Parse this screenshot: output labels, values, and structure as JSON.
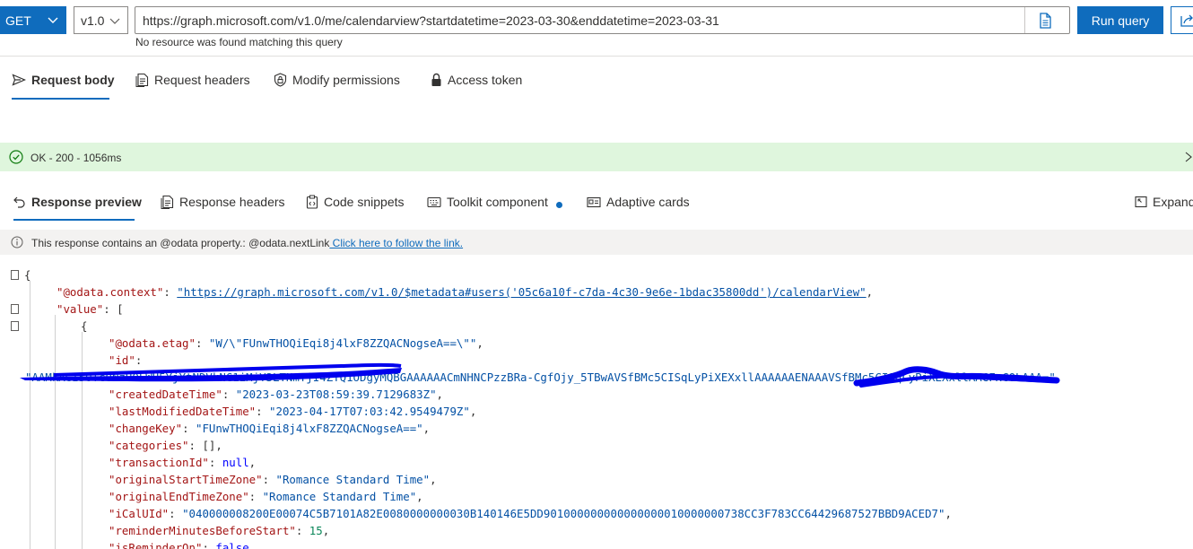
{
  "query": {
    "method": "GET",
    "version": "v1.0",
    "url": "https://graph.microsoft.com/v1.0/me/calendarview?startdatetime=2023-03-30&enddatetime=2023-03-31",
    "hint": "No resource was found matching this query",
    "run_label": "Run query"
  },
  "request_tabs": {
    "body": "Request body",
    "headers": "Request headers",
    "permissions": "Modify permissions",
    "token": "Access token"
  },
  "status": {
    "text": "OK - 200 - 1056ms"
  },
  "response_tabs": {
    "preview": "Response preview",
    "headers": "Response headers",
    "snippets": "Code snippets",
    "toolkit": "Toolkit component",
    "cards": "Adaptive cards",
    "expand": "Expand"
  },
  "info": {
    "text": "This response contains an @odata property.: @odata.nextLink",
    "link": " Click here to follow the link."
  },
  "json": {
    "open_brace": "{",
    "l1_key": "\"@odata.context\"",
    "l1_colon": ": ",
    "l1_value": "\"https://graph.microsoft.com/v1.0/$metadata#users('05c6a10f-c7da-4c30-9e6e-1bdac35800dd')/calendarView\"",
    "comma": ",",
    "l2_key": "\"value\"",
    "l2_rest": ": [",
    "l3": "{",
    "l4_key": "\"@odata.etag\"",
    "l4_value": "\"W/\\\"FUnwTHOQiEqi8j4lxF8ZZQACNogseA==\\\"\"",
    "l5_key": "\"id\"",
    "l5_colon": ":",
    "l6_value": "\"AAMkAGI5OTc0NzU0LWU5YjYtNDVkNC1iMjY3LTNmYjI4ZTQ1ODgyMQBGAAAAAACmNHNCPzzBRa-CgfOjy_5TBwAVSfBMc5CISqLyPiXEXxllAAAAAAENAAAVSfBMc5CISqLyPiXEXxllAACFxCOLAAA=\"",
    "l7_key": "\"createdDateTime\"",
    "l7_value": "\"2023-03-23T08:59:39.7129683Z\"",
    "l8_key": "\"lastModifiedDateTime\"",
    "l8_value": "\"2023-04-17T07:03:42.9549479Z\"",
    "l9_key": "\"changeKey\"",
    "l9_value": "\"FUnwTHOQiEqi8j4lxF8ZZQACNogseA==\"",
    "l10_key": "\"categories\"",
    "l10_value": "[]",
    "l11_key": "\"transactionId\"",
    "l11_value": "null",
    "l12_key": "\"originalStartTimeZone\"",
    "l12_value": "\"Romance Standard Time\"",
    "l13_key": "\"originalEndTimeZone\"",
    "l13_value": "\"Romance Standard Time\"",
    "l14_key": "\"iCalUId\"",
    "l14_value": "\"040000008200E00074C5B7101A82E0080000000030B140146E5DD901000000000000000010000000738CC3F783CC64429687527BBD9ACED7\"",
    "l15_key": "\"reminderMinutesBeforeStart\"",
    "l15_value": "15",
    "l16_key": "\"isReminderOn\"",
    "l16_value": "false"
  },
  "colors": {
    "accent": "#0f6cbd",
    "success_bg": "#dff6dd",
    "info_bg": "#f3f2f1",
    "json_key": "#a31515",
    "json_string": "#0451a5",
    "redaction": "#0000ee"
  },
  "icons": {
    "method_chevron": "chevron-down-icon",
    "doc": "document-icon",
    "share": "share-icon",
    "send": "send-icon",
    "headers": "document-list-icon",
    "permissions": "shield-lock-icon",
    "lock": "lock-icon",
    "check": "check-circle-icon",
    "close": "chevron-right-icon",
    "undo": "undo-arrow-icon",
    "snippets": "clipboard-code-icon",
    "toolkit": "keyboard-icon",
    "cards": "card-icon",
    "expand": "expand-icon",
    "info": "info-icon"
  }
}
